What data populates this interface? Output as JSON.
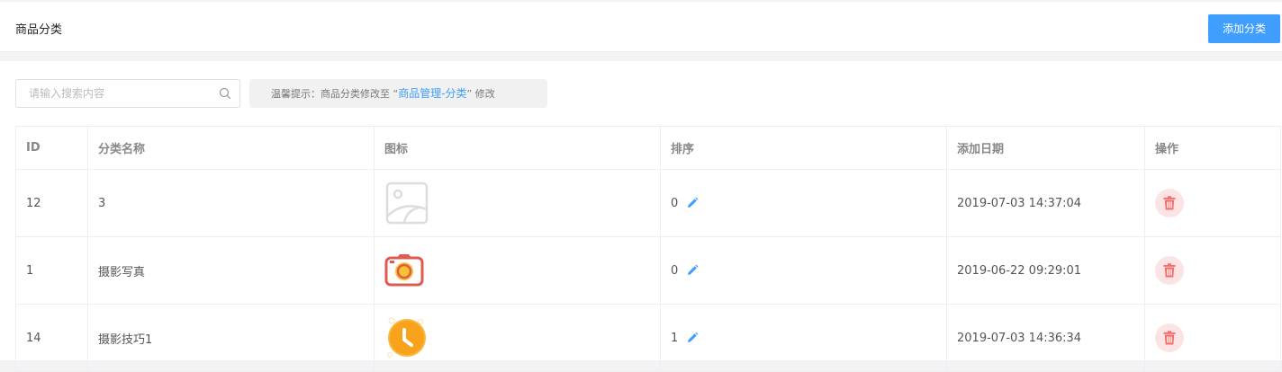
{
  "header": {
    "title": "商品分类",
    "add_button_label": "添加分类"
  },
  "search": {
    "placeholder": "请输入搜索内容",
    "value": ""
  },
  "tip": {
    "prefix": "温馨提示：商品分类修改至 “",
    "link_text": "商品管理-分类",
    "suffix": "” 修改"
  },
  "table": {
    "columns": [
      "ID",
      "分类名称",
      "图标",
      "排序",
      "添加日期",
      "操作"
    ],
    "rows": [
      {
        "id": "12",
        "name": "3",
        "icon": "placeholder-image-icon",
        "sort": "0",
        "date": "2019-07-03 14:37:04"
      },
      {
        "id": "1",
        "name": "摄影写真",
        "icon": "camera-icon",
        "sort": "0",
        "date": "2019-06-22 09:29:01"
      },
      {
        "id": "14",
        "name": "摄影技巧1",
        "icon": "clock-icon",
        "sort": "1",
        "date": "2019-07-03 14:36:34"
      }
    ]
  },
  "colors": {
    "primary": "#409eff",
    "delete": "#f56c6c",
    "delete_bg": "#fde4e4"
  }
}
